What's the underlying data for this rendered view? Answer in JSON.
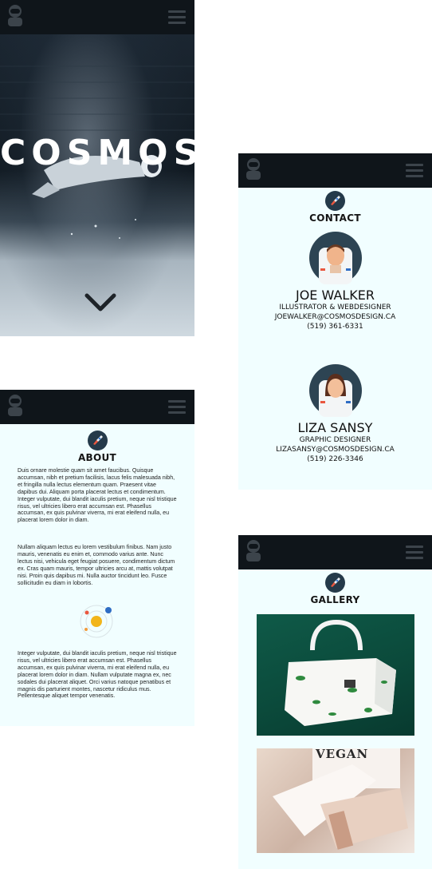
{
  "colors": {
    "topbar": "#0f151a",
    "screen_bg": "#f1feff",
    "accent_rocket": "#243a4a",
    "portrait_bg": "#2d4453"
  },
  "hero": {
    "title": "COSMOS"
  },
  "about": {
    "title": "ABOUT",
    "paragraphs": [
      "Duis ornare molestie quam sit amet faucibus. Quisque accumsan, nibh et pretium facilisis, lacus felis malesuada nibh, et fringilla nulla lectus elementum quam. Praesent vitae dapibus dui. Aliquam porta placerat lectus et condimentum. Integer vulputate, dui blandit iaculis pretium, neque nisl tristique risus, vel ultricies libero erat accumsan est. Phasellus accumsan, ex quis pulvinar viverra, mi erat eleifend nulla, eu placerat lorem dolor in diam.",
      "Nullam aliquam lectus eu lorem vestibulum finibus. Nam justo mauris, venenatis eu enim et, commodo varius ante. Nunc lectus nisi, vehicula eget feugiat posuere, condimentum dictum ex. Cras quam mauris, tempor ultricies arcu at, mattis volutpat nisi. Proin quis dapibus mi. Nulla auctor tincidunt leo. Fusce sollicitudin eu diam in lobortis.",
      "Integer vulputate, dui blandit iaculis pretium, neque nisl tristique risus, vel ultricies libero erat accumsan est. Phasellus accumsan, ex quis pulvinar viverra, mi erat eleifend nulla, eu placerat lorem dolor in diam. Nullam vulputate magna ex, nec sodales dui placerat aliquet. Orci varius natoque penatibus et magnis dis parturient montes, nascetur ridiculus mus. Pellentesque aliquet tempor venenatis."
    ]
  },
  "contact": {
    "title": "CONTACT",
    "people": [
      {
        "name": "JOE WALKER",
        "role": "ILLUSTRATOR & WEBDESIGNER",
        "email": "JOEWALKER@COSMOSDESIGN.CA",
        "phone": "(519) 361-6331"
      },
      {
        "name": "LIZA SANSY",
        "role": "GRAPHIC DESIGNER",
        "email": "LIZASANSY@COSMOSDESIGN.CA",
        "phone": "(519) 226-3346"
      }
    ]
  },
  "gallery": {
    "title": "GALLERY",
    "photo2_caption": "VEGAN"
  },
  "icons": [
    "avatar-icon",
    "menu-icon",
    "chevron-down-icon",
    "rocket-icon",
    "solar-system-icon",
    "astronaut-portrait-icon"
  ]
}
